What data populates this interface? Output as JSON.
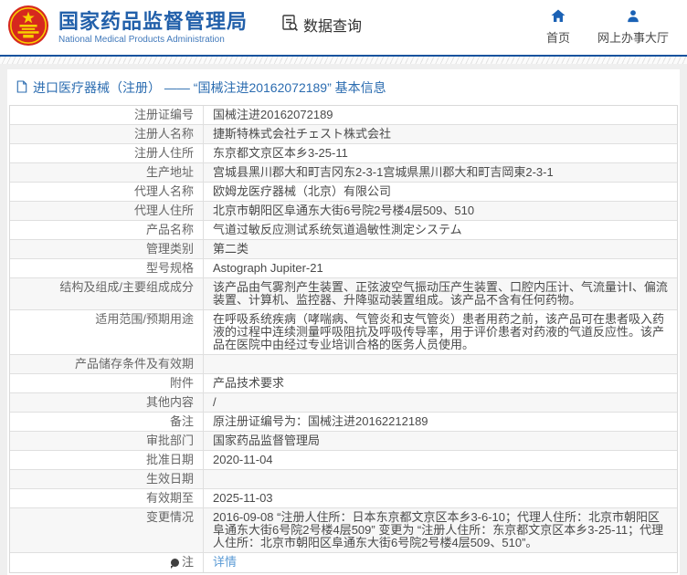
{
  "header": {
    "logo_title": "国家药品监督管理局",
    "logo_subtitle": "National Medical Products Administration",
    "data_query_label": "数据查询",
    "nav_home": "首页",
    "nav_hall": "网上办事大厅"
  },
  "breadcrumb": {
    "text": "进口医疗器械（注册） —— “国械注进20162072189” 基本信息"
  },
  "table": {
    "rows": [
      {
        "label": "注册证编号",
        "value": "国械注进20162072189"
      },
      {
        "label": "注册人名称",
        "value": "捷斯特株式会社チェスト株式会社"
      },
      {
        "label": "注册人住所",
        "value": "东京都文京区本乡3-25-11"
      },
      {
        "label": "生产地址",
        "value": "宫城县黑川郡大和町吉冈东2-3-1宫城県黒川郡大和町吉岡東2-3-1"
      },
      {
        "label": "代理人名称",
        "value": "欧姆龙医疗器械（北京）有限公司"
      },
      {
        "label": "代理人住所",
        "value": "北京市朝阳区阜通东大街6号院2号楼4层509、510"
      },
      {
        "label": "产品名称",
        "value": "气道过敏反应测试系统気道過敏性測定システム"
      },
      {
        "label": "管理类别",
        "value": "第二类"
      },
      {
        "label": "型号规格",
        "value": "Astograph Jupiter-21"
      },
      {
        "label": "结构及组成/主要组成成分",
        "value": "该产品由气雾剂产生装置、正弦波空气振动压产生装置、口腔内压计、气流量计Ⅰ、偏流装置、计算机、监控器、升降驱动装置组成。该产品不含有任何药物。"
      },
      {
        "label": "适用范围/预期用途",
        "value": "在呼吸系统疾病（哮喘病、气管炎和支气管炎）患者用药之前，该产品可在患者吸入药液的过程中连续测量呼吸阻抗及呼吸传导率，用于评价患者对药液的气道反应性。该产品在医院中由经过专业培训合格的医务人员使用。"
      },
      {
        "label": "产品储存条件及有效期",
        "value": ""
      },
      {
        "label": "附件",
        "value": "产品技术要求"
      },
      {
        "label": "其他内容",
        "value": "/"
      },
      {
        "label": "备注",
        "value": "原注册证编号为：国械注进20162212189"
      },
      {
        "label": "审批部门",
        "value": "国家药品监督管理局"
      },
      {
        "label": "批准日期",
        "value": "2020-11-04"
      },
      {
        "label": "生效日期",
        "value": ""
      },
      {
        "label": "有效期至",
        "value": "2025-11-03"
      },
      {
        "label": "变更情况",
        "value": "2016-09-08 “注册人住所：日本东京都文京区本乡3-6-10；代理人住所：北京市朝阳区阜通东大街6号院2号楼4层509” 变更为 “注册人住所：东京都文京区本乡3-25-11；代理人住所：北京市朝阳区阜通东大街6号院2号楼4层509、510”。"
      },
      {
        "label": "注",
        "value": "详情",
        "note_icon": true,
        "link": true
      }
    ]
  },
  "colors": {
    "brand_blue": "#2260aa",
    "divider_blue": "#14539e",
    "link_blue": "#5b9bd5",
    "nav_icon_blue": "#1b62b5",
    "emblem_red": "#d6281e",
    "emblem_gold": "#f8d000"
  }
}
